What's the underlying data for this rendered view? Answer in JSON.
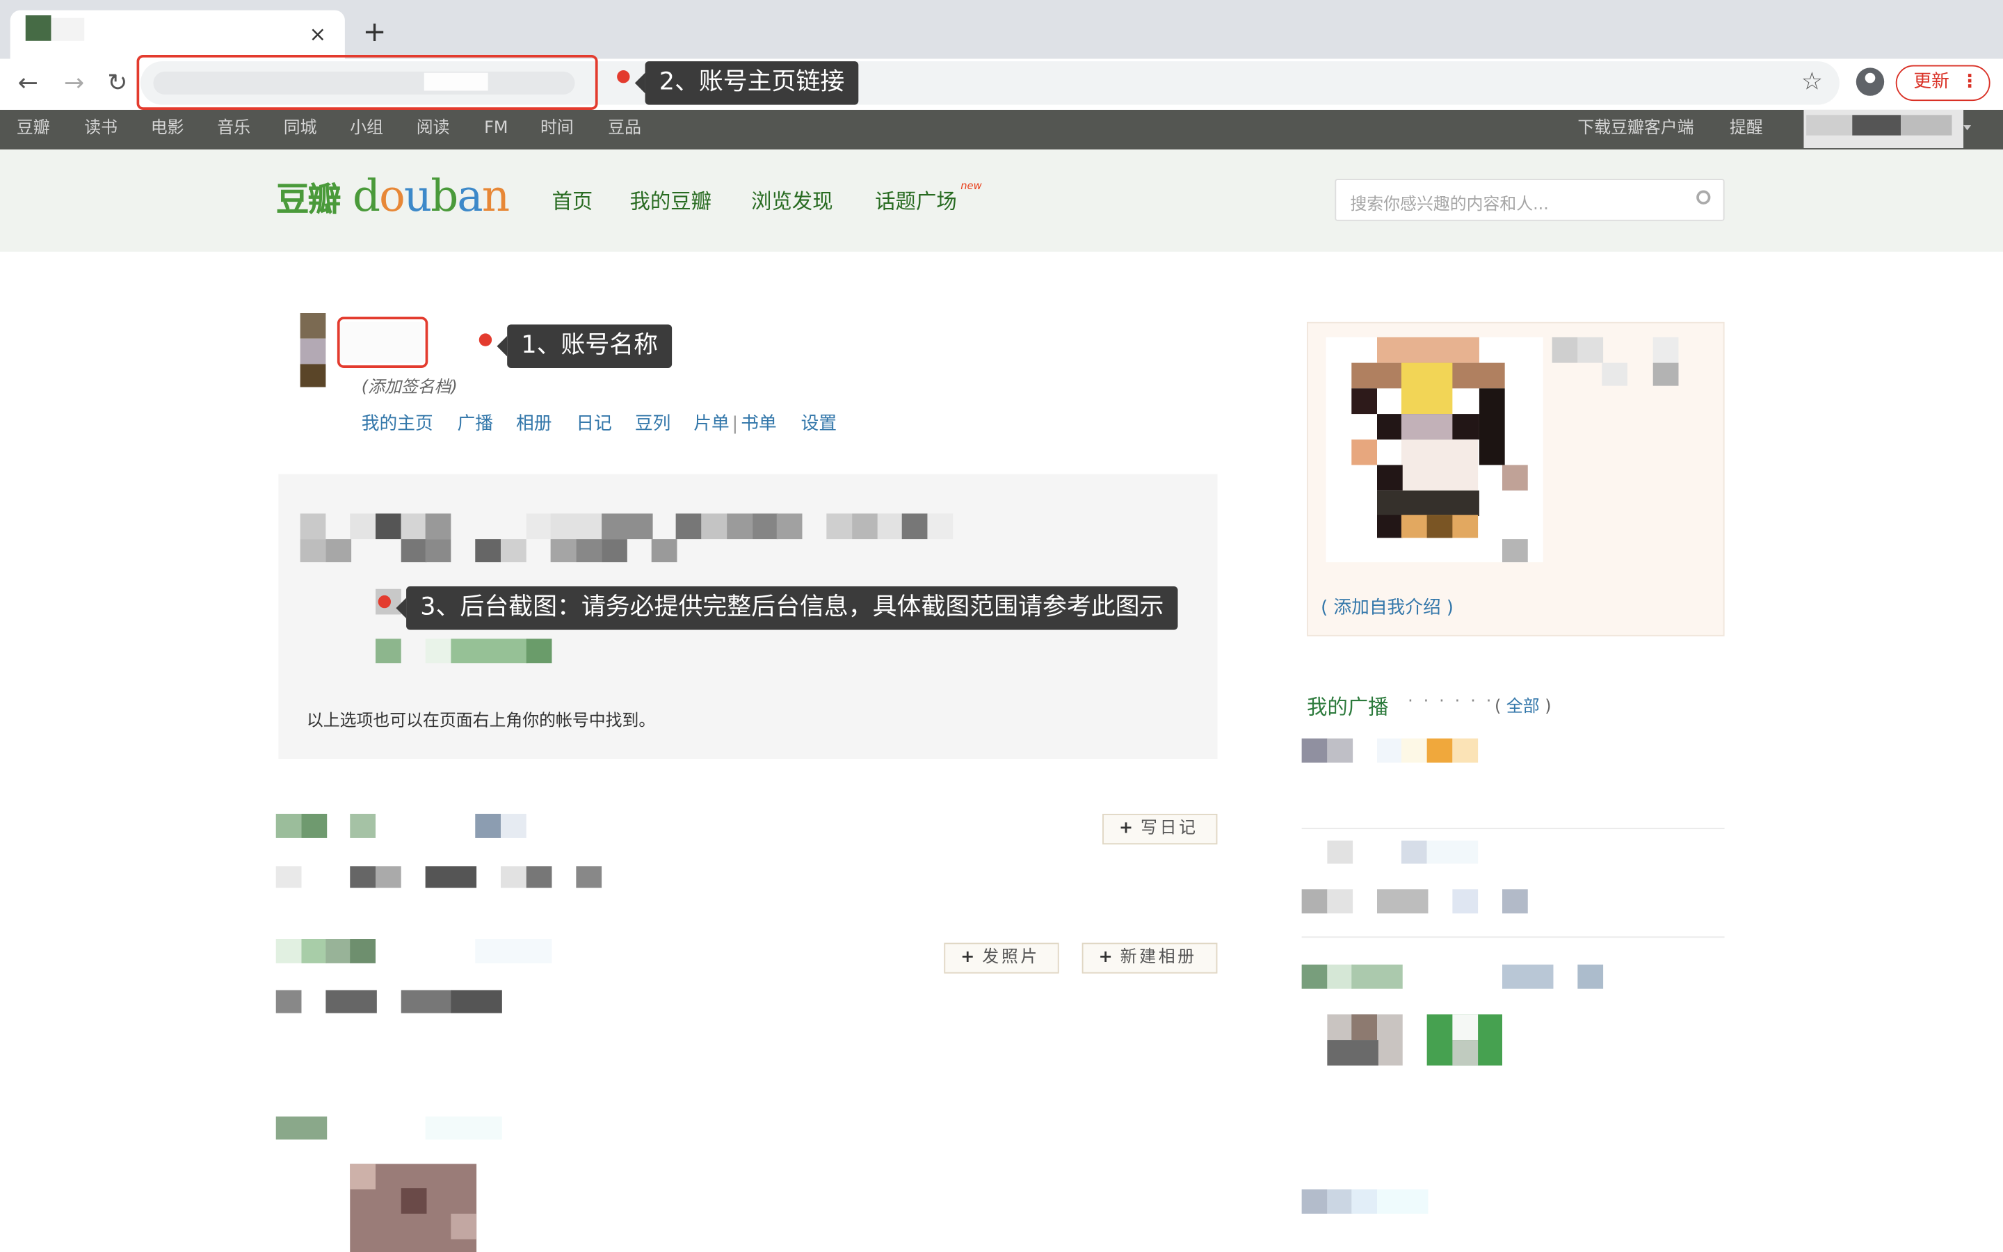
{
  "browser": {
    "tab_close": "×",
    "new_tab": "+",
    "back": "←",
    "forward": "→",
    "reload": "↻",
    "star": "☆",
    "update_label": "更新",
    "menu_dots": "⋮"
  },
  "topnav": {
    "items": [
      "豆瓣",
      "读书",
      "电影",
      "音乐",
      "同城",
      "小组",
      "阅读",
      "FM",
      "时间",
      "豆品"
    ],
    "download": "下载豆瓣客户端",
    "remind": "提醒"
  },
  "header": {
    "logo_cn": "豆瓣",
    "logo_en": [
      "d",
      "o",
      "u",
      "b",
      "a",
      "n"
    ],
    "nav": [
      "首页",
      "我的豆瓣",
      "浏览发现",
      "话题广场"
    ],
    "new_badge": "new",
    "search_placeholder": "搜索你感兴趣的内容和人..."
  },
  "profile": {
    "signature": "(添加签名档)",
    "subnav": [
      "我的主页",
      "广播",
      "相册",
      "日记",
      "豆列",
      "片单",
      "书单",
      "设置"
    ],
    "subnav_sep": "|",
    "box_note": "以上选项也可以在页面右上角你的帐号中找到。",
    "write_diary": "写日记",
    "post_photo": "发照片",
    "new_album": "新建相册",
    "plus": "+"
  },
  "sidebar": {
    "intro_link": "( 添加自我介绍 )",
    "broadcast_title": "我的广播",
    "broadcast_dots": "· · · · · ·",
    "all_open": "( ",
    "all_link": "全部",
    "all_close": " )"
  },
  "annotations": {
    "a1": "1、账号名称",
    "a2": "2、账号主页链接",
    "a3": "3、后台截图：请务必提供完整后台信息，具体截图范围请参考此图示"
  },
  "colors": {
    "douban_green": "#4a9a3a",
    "link_blue": "#3377aa",
    "annotation_red": "#e33b2e",
    "tooltip_bg": "#3b3b3b",
    "topnav_bg": "#545652"
  }
}
